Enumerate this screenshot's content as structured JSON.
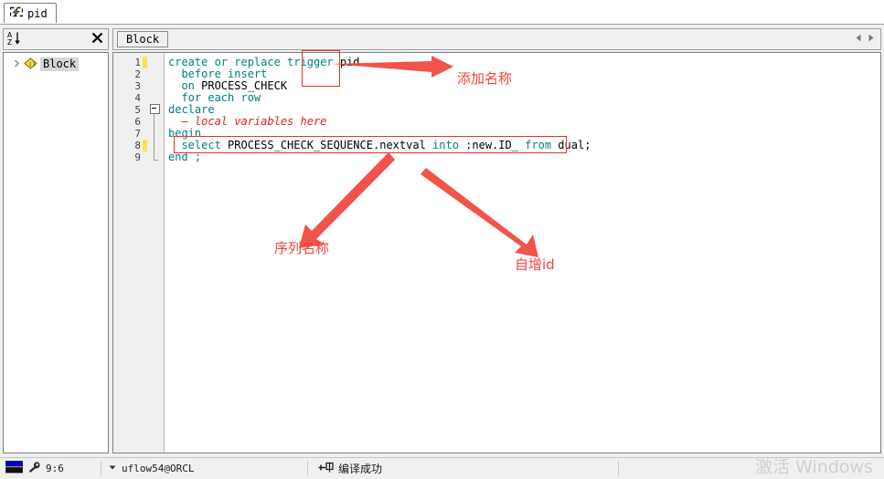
{
  "window": {
    "tab": {
      "label": "pid",
      "icon": "lightning-bolt-icon"
    }
  },
  "sidebar": {
    "toolbar": {
      "sort_icon": "sort-az-icon",
      "close_icon": "close-icon"
    },
    "tree": {
      "items": [
        {
          "label": "Block",
          "icon": "block-diamond-icon",
          "expander": "chevron-right-icon"
        }
      ]
    }
  },
  "editor": {
    "toolbar": {
      "block_button": "Block",
      "scroll_left_icon": "scroll-left-icon",
      "scroll_right_icon": "scroll-right-icon"
    },
    "line_numbers": [
      "1",
      "2",
      "3",
      "4",
      "5",
      "6",
      "7",
      "8",
      "9"
    ],
    "code_lines": [
      {
        "n": 1,
        "segments": [
          {
            "t": "create or replace trigger ",
            "c": "kw"
          },
          {
            "t": "pid",
            "c": "id"
          }
        ]
      },
      {
        "n": 2,
        "segments": [
          {
            "t": "  before insert",
            "c": "kw"
          }
        ]
      },
      {
        "n": 3,
        "segments": [
          {
            "t": "  on ",
            "c": "kw"
          },
          {
            "t": "PROCESS_CHECK",
            "c": "id"
          }
        ]
      },
      {
        "n": 4,
        "segments": [
          {
            "t": "  for each row",
            "c": "kw"
          }
        ]
      },
      {
        "n": 5,
        "segments": [
          {
            "t": "declare",
            "c": "kw"
          }
        ]
      },
      {
        "n": 6,
        "segments": [
          {
            "t": "  — local variables here",
            "c": "cmt"
          }
        ]
      },
      {
        "n": 7,
        "segments": [
          {
            "t": "begin",
            "c": "kw"
          }
        ]
      },
      {
        "n": 8,
        "segments": [
          {
            "t": "  select ",
            "c": "kw"
          },
          {
            "t": "PROCESS_CHECK_SEQUENCE",
            "c": "id"
          },
          {
            "t": ".",
            "c": "id"
          },
          {
            "t": "nextval ",
            "c": "id"
          },
          {
            "t": "into ",
            "c": "kw"
          },
          {
            "t": ":new.ID_ ",
            "c": "id"
          },
          {
            "t": "from ",
            "c": "kw"
          },
          {
            "t": "dual;",
            "c": "id"
          }
        ]
      },
      {
        "n": 9,
        "segments": [
          {
            "t": "end ;",
            "c": "kw"
          }
        ]
      }
    ],
    "change_bar_lines": [
      1,
      8
    ]
  },
  "annotations": [
    {
      "id": "add-name",
      "text": "添加名称",
      "target": "pid"
    },
    {
      "id": "sequence-name",
      "text": "序列名称",
      "target": "PROCESS_CHECK_SEQUENCE"
    },
    {
      "id": "auto-increment-id",
      "text": "自增id",
      "target": ":new.ID_"
    }
  ],
  "statusbar": {
    "flag_icon": "flag-icon",
    "wrench_icon": "wrench-icon",
    "cursor_position": "9:6",
    "connection_dropdown_icon": "chevron-down-icon",
    "connection": "uflow54@ORCL",
    "compile_icon": "compile-icon",
    "compile_status": "编译成功"
  },
  "watermark": "激活 Windows",
  "colors": {
    "keyword": "#008080",
    "comment": "#e02020",
    "annotation": "#f1443c",
    "change_bar": "#ffe14d",
    "panel_bg": "#f0f0f0"
  }
}
